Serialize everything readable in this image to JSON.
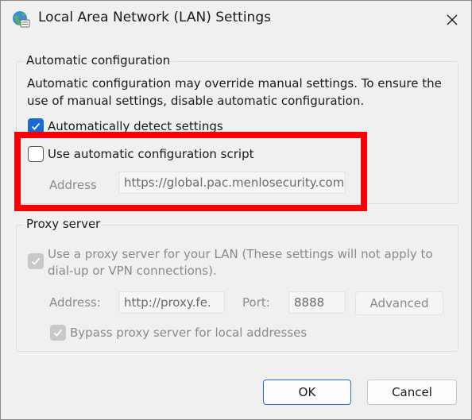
{
  "window": {
    "title": "Local Area Network (LAN) Settings"
  },
  "auto_config": {
    "legend": "Automatic configuration",
    "description_line1": "Automatic configuration may override manual settings.  To ensure the",
    "description_line2": "use of manual settings, disable automatic configuration.",
    "detect_settings_label": "Automatically detect settings",
    "detect_settings_checked": true,
    "use_script_label": "Use automatic configuration script",
    "use_script_checked": false,
    "address_label": "Address",
    "address_value": "https://global.pac.menlosecurity.com"
  },
  "proxy": {
    "legend": "Proxy server",
    "use_proxy_line1": "Use a proxy server for your LAN (These settings will not apply to",
    "use_proxy_line2": "dial-up or VPN connections).",
    "use_proxy_checked": true,
    "address_label": "Address:",
    "address_value": "http://proxy.fe.",
    "port_label": "Port:",
    "port_value": "8888",
    "advanced_label": "Advanced",
    "bypass_label": "Bypass proxy server for local addresses",
    "bypass_checked": true
  },
  "buttons": {
    "ok": "OK",
    "cancel": "Cancel"
  },
  "colors": {
    "accent": "#1a6ad3",
    "highlight": "#fb0000"
  }
}
